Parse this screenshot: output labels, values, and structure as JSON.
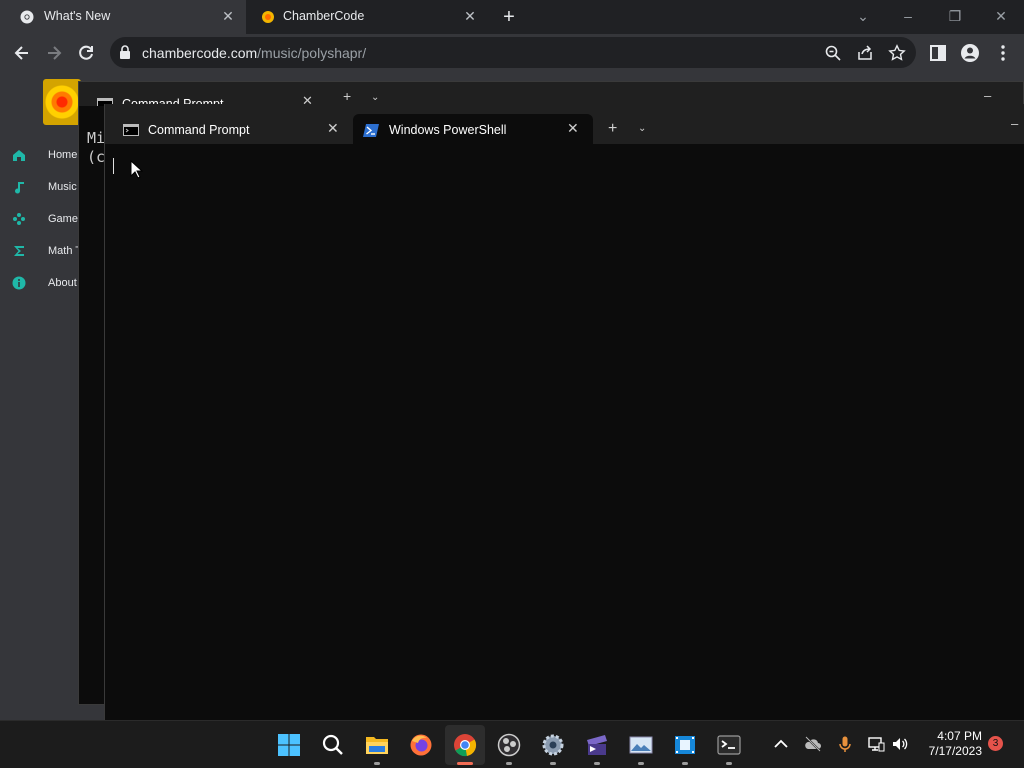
{
  "browser": {
    "tabs": [
      {
        "title": "What's New",
        "favicon": "chrome-logo-icon"
      },
      {
        "title": "ChamberCode",
        "favicon": "chambercode-favicon-icon"
      }
    ],
    "address": {
      "host": "chambercode.com",
      "path": "/music/polyshapr/"
    }
  },
  "website": {
    "nav": [
      {
        "label": "Home",
        "icon": "home-icon"
      },
      {
        "label": "Music",
        "icon": "music-note-icon"
      },
      {
        "label": "Games",
        "icon": "gamepad-icon"
      },
      {
        "label": "Math T",
        "icon": "sigma-icon"
      },
      {
        "label": "About",
        "icon": "info-icon"
      }
    ],
    "accent_color": "#1fb8a8"
  },
  "terminal_back": {
    "tab_title": "Command Prompt",
    "lines": [
      "Mi",
      "(c"
    ]
  },
  "terminal_front": {
    "tabs": [
      {
        "title": "Command Prompt",
        "icon": "cmd-icon"
      },
      {
        "title": "Windows PowerShell",
        "icon": "powershell-icon",
        "active": true
      }
    ]
  },
  "taskbar": {
    "apps": [
      "start-icon",
      "search-icon",
      "file-explorer-icon",
      "firefox-icon",
      "chrome-icon",
      "obs-icon",
      "settings-gear-icon",
      "video-editor-icon",
      "photo-viewer-icon",
      "film-app-icon",
      "terminal-icon"
    ],
    "time": "4:07 PM",
    "date": "7/17/2023",
    "notification_count": "3"
  }
}
